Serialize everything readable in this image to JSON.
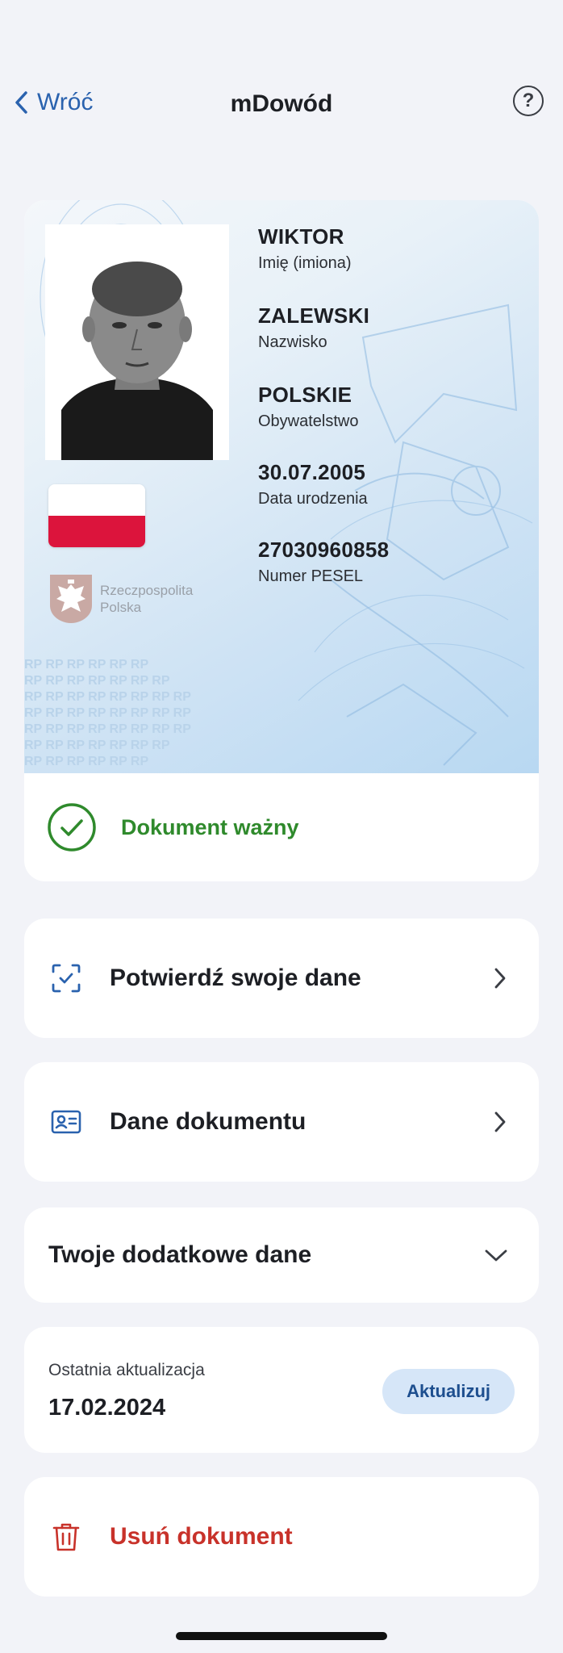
{
  "nav": {
    "back_label": "Wróć",
    "title": "mDowód",
    "help_label": "?"
  },
  "id_card": {
    "fields": [
      {
        "value": "WIKTOR",
        "label": "Imię (imiona)"
      },
      {
        "value": "ZALEWSKI",
        "label": "Nazwisko"
      },
      {
        "value": "POLSKIE",
        "label": "Obywatelstwo"
      },
      {
        "value": "30.07.2005",
        "label": "Data urodzenia"
      },
      {
        "value": "27030960858",
        "label": "Numer PESEL"
      }
    ],
    "emblem_line1": "Rzeczpospolita",
    "emblem_line2": "Polska",
    "pattern_text": "RP RP RP RP RP RP"
  },
  "status": {
    "text": "Dokument ważny",
    "color": "#2f8a2c"
  },
  "actions": {
    "confirm_label": "Potwierdź swoje dane",
    "document_data_label": "Dane dokumentu",
    "extra_data_label": "Twoje dodatkowe dane"
  },
  "update": {
    "title": "Ostatnia aktualizacja",
    "date": "17.02.2024",
    "button_label": "Aktualizuj"
  },
  "delete": {
    "label": "Usuń dokument",
    "color": "#c8322a"
  },
  "colors": {
    "accent": "#2a62ae",
    "background": "#f2f3f8",
    "flag_red": "#dc143c"
  },
  "icons": [
    "chevron-left-icon",
    "help-icon",
    "check-circle-icon",
    "scan-check-icon",
    "id-card-icon",
    "chevron-right-icon",
    "chevron-down-icon",
    "trash-icon"
  ]
}
